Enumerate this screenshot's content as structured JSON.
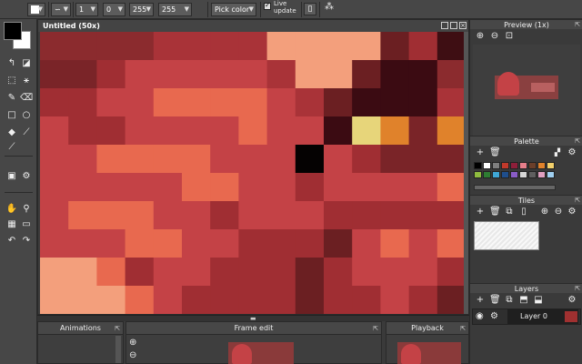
{
  "toolbar": {
    "brush_size": "1",
    "opacity_a": "0",
    "value_b": "255",
    "value_c": "255",
    "pick_color_label": "Pick color",
    "live_update_label": "Live update",
    "live_update_checked": true
  },
  "canvas": {
    "title": "Untitled   (50x)",
    "grid": [
      [
        "#8b2b2e",
        "#8b2b2e",
        "#8b2b2e",
        "#8b2b2e",
        "#a93338",
        "#a93338",
        "#a93338",
        "#a93338",
        "#f39f7c",
        "#f39f7c",
        "#f39f7c",
        "#f39f7c",
        "#6b1f22",
        "#a02e33",
        "#3e0e13"
      ],
      [
        "#7a2428",
        "#7a2428",
        "#a02e33",
        "#c44246",
        "#c44246",
        "#c44246",
        "#c44246",
        "#c44246",
        "#a93338",
        "#f39f7c",
        "#f39f7c",
        "#6b1f22",
        "#3b0b12",
        "#3b0b12",
        "#8b2b2e"
      ],
      [
        "#a02e33",
        "#a02e33",
        "#c44246",
        "#c44246",
        "#e8694f",
        "#e8694f",
        "#e8694f",
        "#e8694f",
        "#c44246",
        "#a93338",
        "#6b1f22",
        "#3b0b12",
        "#3b0b12",
        "#3b0b12",
        "#a93338"
      ],
      [
        "#c44246",
        "#a02e33",
        "#a02e33",
        "#c44246",
        "#c44246",
        "#c44246",
        "#c44246",
        "#e8694f",
        "#c44246",
        "#c44246",
        "#3b0b12",
        "#e7d57a",
        "#e0822b",
        "#7a2428",
        "#e0822b"
      ],
      [
        "#c44246",
        "#c44246",
        "#e8694f",
        "#e8694f",
        "#e8694f",
        "#e8694f",
        "#c44246",
        "#c44246",
        "#c44246",
        "#050202",
        "#c44246",
        "#a02e33",
        "#7a2428",
        "#7a2428",
        "#7a2428"
      ],
      [
        "#c44246",
        "#c44246",
        "#c44246",
        "#c44246",
        "#c44246",
        "#e8694f",
        "#e8694f",
        "#c44246",
        "#c44246",
        "#a02e33",
        "#c44246",
        "#c44246",
        "#c44246",
        "#c44246",
        "#e8694f"
      ],
      [
        "#c44246",
        "#e8694f",
        "#e8694f",
        "#e8694f",
        "#c44246",
        "#c44246",
        "#a02e33",
        "#c44246",
        "#c44246",
        "#c44246",
        "#a02e33",
        "#a02e33",
        "#a02e33",
        "#a02e33",
        "#a02e33"
      ],
      [
        "#c44246",
        "#c44246",
        "#c44246",
        "#e8694f",
        "#e8694f",
        "#c44246",
        "#c44246",
        "#a02e33",
        "#a02e33",
        "#a02e33",
        "#6b1f22",
        "#c44246",
        "#e8694f",
        "#c44246",
        "#e8694f"
      ],
      [
        "#f39f7c",
        "#f39f7c",
        "#e8694f",
        "#a02e33",
        "#c44246",
        "#c44246",
        "#a02e33",
        "#a02e33",
        "#a02e33",
        "#6b1f22",
        "#a02e33",
        "#c44246",
        "#c44246",
        "#c44246",
        "#a02e33"
      ],
      [
        "#f39f7c",
        "#f39f7c",
        "#f39f7c",
        "#e8694f",
        "#c44246",
        "#a02e33",
        "#a02e33",
        "#a02e33",
        "#a02e33",
        "#6b1f22",
        "#a02e33",
        "#a02e33",
        "#c44246",
        "#a02e33",
        "#6b1f22"
      ]
    ]
  },
  "panels": {
    "animations": "Animations",
    "frame_edit": "Frame edit",
    "playback": "Playback",
    "preview": "Preview (1x)",
    "palette": "Palette",
    "tiles": "Tiles",
    "layers": "Layers",
    "layer_name": "Layer 0"
  },
  "palette_colors": [
    "#000000",
    "#ffffff",
    "#7f7f7f",
    "#c0392b",
    "#8e1f3a",
    "#e67e8a",
    "#6b3f2a",
    "#e0822b",
    "#f2d06b",
    "#8fbc3f",
    "#2e7d32",
    "#3fa7d6",
    "#1f4e8c",
    "#8a5cc7",
    "#d6d6d6",
    "#5f5f5f",
    "#e0a0c0",
    "#a0d0f0"
  ],
  "colors": {
    "primary": "#000000",
    "secondary": "#ffffff"
  }
}
